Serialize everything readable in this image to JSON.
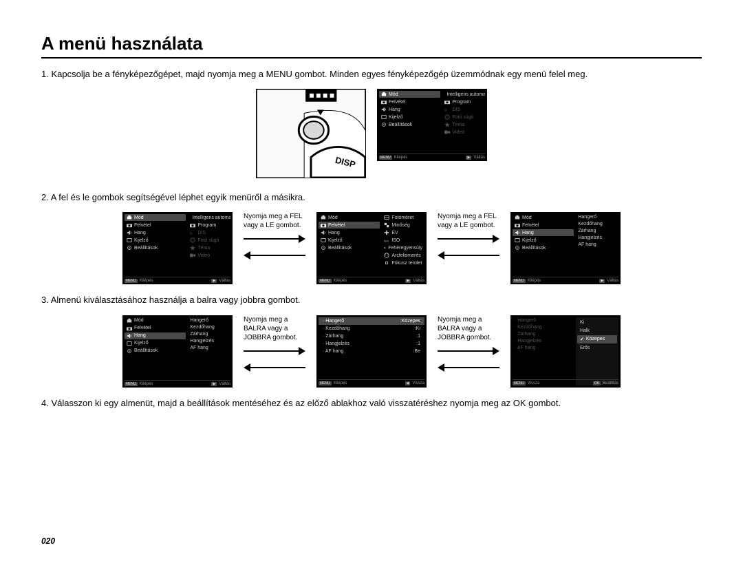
{
  "title": "A menü használata",
  "pagenum": "020",
  "steps": {
    "s1": "1. Kapcsolja be a fényképezőgépet, majd nyomja meg a MENU gombot. Minden egyes fényképezőgép üzemmódnak egy menü felel meg.",
    "s2": "2. A fel és le gombok segítségével léphet egyik menüről a másikra.",
    "s3": "3. Almenü kiválasztásához használja a balra vagy jobbra gombot.",
    "s4": "4. Válasszon ki egy almenüt, majd a beállítások mentéséhez és az előző ablakhoz való visszatéréshez nyomja meg az OK gombot."
  },
  "hints": {
    "updown": "Nyomja meg a FEL vagy a LE gombot.",
    "leftright": "Nyomja meg a BALRA vagy a JOBBRA gombot."
  },
  "camera_label": "DISP",
  "left_menu": [
    "Mód",
    "Felvétel",
    "Hang",
    "Kijelző",
    "Beállítások"
  ],
  "right_mode": [
    "Intelligens automata",
    "Program",
    "DIS",
    "Fotó súgó",
    "Téma",
    "Videó"
  ],
  "right_shoot": [
    "Fotóméret",
    "Minőség",
    "EV",
    "ISO",
    "Fehéregyensúly",
    "Arcfelismerés",
    "Fókusz terület"
  ],
  "right_sound": [
    "Hangerő",
    "Kezdőhang",
    "Zárhang",
    "Hangjelzés",
    "AF hang"
  ],
  "sound_vals": {
    "Hangerő": "Közepes",
    "Kezdőhang": "Ki",
    "Zárhang": "1",
    "Hangjelzés": "1",
    "AF hang": "Be"
  },
  "volume_opts": [
    "Ki",
    "Halk",
    "Közepes",
    "Erős"
  ],
  "foot": {
    "exit_badge": "MENU",
    "exit": "Kilépés",
    "switch_badge": "▶",
    "switch": "Váltás",
    "back_badge": "◀",
    "back": "Vissza",
    "set_badge": "OK",
    "set": "Beállítás"
  }
}
